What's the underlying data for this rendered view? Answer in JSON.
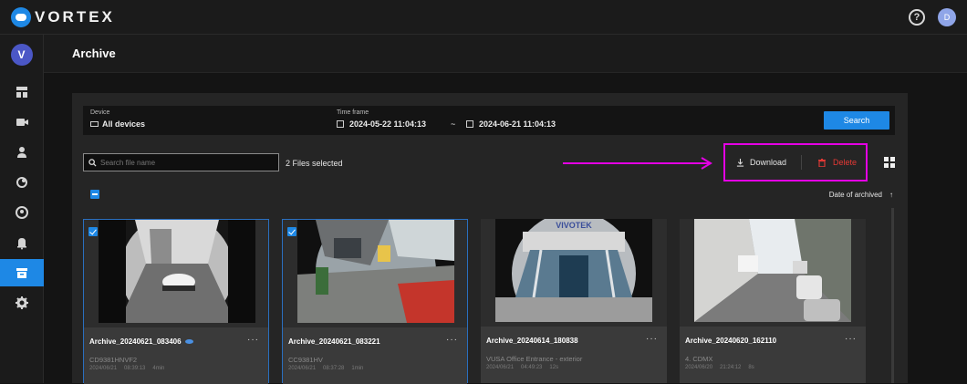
{
  "app": {
    "logo_text": "VORTEX",
    "help_glyph": "?",
    "user_initial": "D",
    "brand_color": "#1e88e5"
  },
  "sidebar": {
    "avatar_initial": "V",
    "items": [
      {
        "icon": "dashboard-icon"
      },
      {
        "icon": "camera-icon"
      },
      {
        "icon": "person-icon"
      },
      {
        "icon": "tag-icon"
      },
      {
        "icon": "face-icon"
      },
      {
        "icon": "bell-icon"
      },
      {
        "icon": "archive-icon",
        "active": true
      },
      {
        "icon": "gear-icon"
      }
    ]
  },
  "header": {
    "title": "Archive"
  },
  "filter": {
    "device_label": "Device",
    "device_value": "All devices",
    "timeframe_label": "Time frame",
    "start": "2024-05-22  11:04:13",
    "separator": "~",
    "end": "2024-06-21  11:04:13",
    "search_button": "Search"
  },
  "toolbar": {
    "search_placeholder": "Search file name",
    "files_selected": "2 Files selected",
    "download_label": "Download",
    "delete_label": "Delete",
    "highlight_color": "#e400e4"
  },
  "sort": {
    "label": "Date of archived",
    "arrow": "↑"
  },
  "cards": [
    {
      "title": "Archive_20240621_083406",
      "device": "CD9381HNVF2",
      "date": "2024/06/21",
      "time": "08:39:13",
      "duration": "4min",
      "selected": true,
      "has_eye": true
    },
    {
      "title": "Archive_20240621_083221",
      "device": "CC9381HV",
      "date": "2024/06/21",
      "time": "08:37:28",
      "duration": "1min",
      "selected": true,
      "has_eye": false
    },
    {
      "title": "Archive_20240614_180838",
      "device": "VUSA Office Entrance - exterior",
      "date": "2024/06/21",
      "time": "04:49:23",
      "duration": "12s",
      "selected": false,
      "has_eye": false
    },
    {
      "title": "Archive_20240620_162110",
      "device": "4. CDMX",
      "date": "2024/06/20",
      "time": "21:24:12",
      "duration": "8s",
      "selected": false,
      "has_eye": false
    }
  ],
  "card_more_glyph": "···",
  "thumb_sign_text": "VIVOTEK"
}
